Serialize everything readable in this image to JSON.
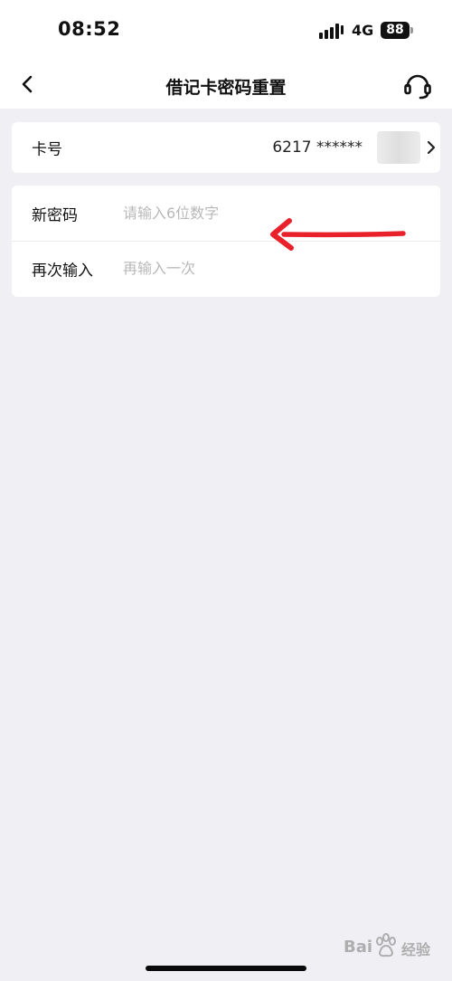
{
  "status_bar": {
    "time": "08:52",
    "network": "4G",
    "battery_level": "88"
  },
  "nav": {
    "title": "借记卡密码重置",
    "back_icon": "chevron-left-icon",
    "service_icon": "headset-icon"
  },
  "card_number": {
    "label": "卡号",
    "value": "6217 ******"
  },
  "password_form": {
    "new_password": {
      "label": "新密码",
      "placeholder": "请输入6位数字",
      "value": ""
    },
    "confirm_password": {
      "label": "再次输入",
      "placeholder": "再输入一次",
      "value": ""
    }
  },
  "annotation": {
    "type": "red-arrow",
    "color": "#e8212b"
  },
  "watermark": {
    "text_left": "Bai",
    "text_right": "经验"
  },
  "colors": {
    "background": "#efeff4",
    "card": "#ffffff",
    "placeholder": "#b8b8b8"
  }
}
